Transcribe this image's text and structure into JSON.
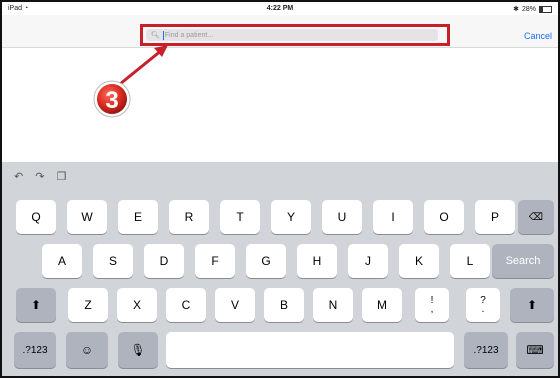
{
  "status_bar": {
    "device": "iPad",
    "wifi_icon": "wifi-icon",
    "time": "4:22 PM",
    "bluetooth": "✱",
    "battery": "28%"
  },
  "navbar": {
    "search_placeholder": "Find a patient...",
    "cancel_label": "Cancel"
  },
  "annotation": {
    "step_number": "3",
    "highlight_color": "#c8202a"
  },
  "keyboard": {
    "row1": [
      "Q",
      "W",
      "E",
      "R",
      "T",
      "Y",
      "U",
      "I",
      "O",
      "P"
    ],
    "row2": [
      "A",
      "S",
      "D",
      "F",
      "G",
      "H",
      "J",
      "K",
      "L"
    ],
    "row3": [
      "Z",
      "X",
      "C",
      "V",
      "B",
      "N",
      "M"
    ],
    "punct1": {
      "top": "!",
      "bottom": ","
    },
    "punct2": {
      "top": "?",
      "bottom": "."
    },
    "search_label": "Search",
    "numbers_label": ".?123",
    "accent_color": "#1b6df5"
  }
}
